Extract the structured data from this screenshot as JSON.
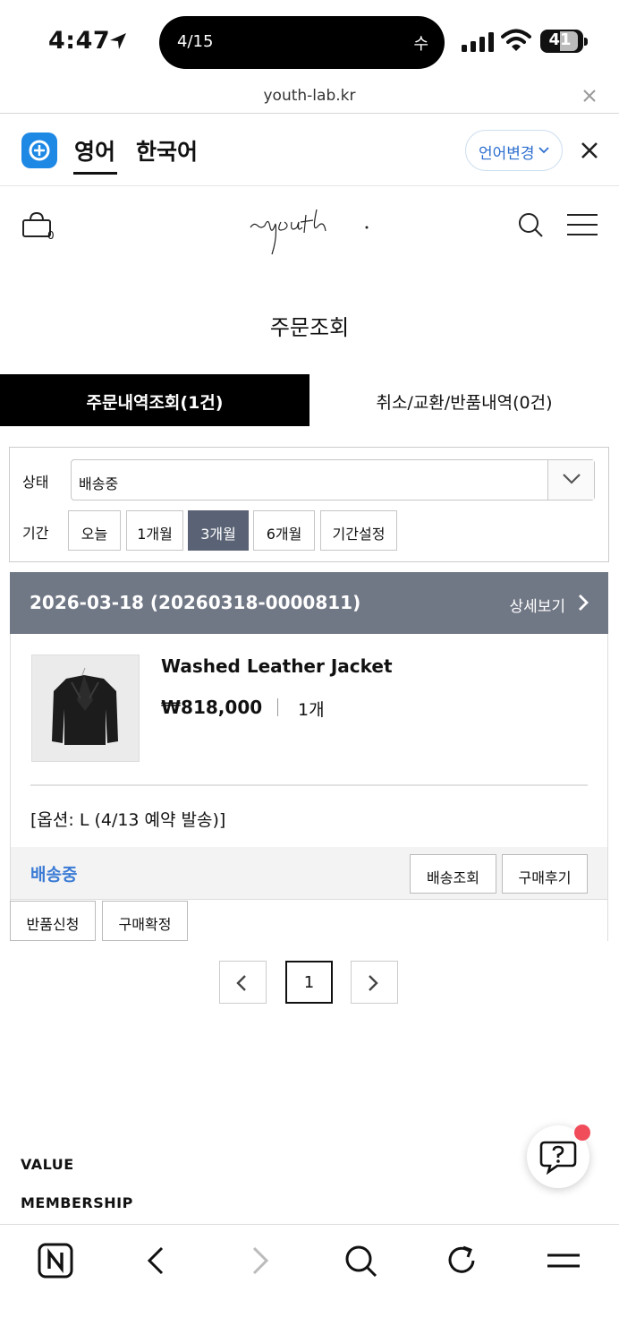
{
  "status": {
    "time": "4:47",
    "island_left": "4/15",
    "island_right": "수",
    "battery": "41"
  },
  "browser": {
    "url": "youth-lab.kr"
  },
  "translate": {
    "lang_active": "영어",
    "lang_other": "한국어",
    "change_label": "언어변경"
  },
  "header": {
    "cart_count": "0",
    "brand": "youth."
  },
  "page": {
    "title": "주문조회"
  },
  "tabs": [
    {
      "label": "주문내역조회(1건)",
      "active": true
    },
    {
      "label": "취소/교환/반품내역(0건)",
      "active": false
    }
  ],
  "filter": {
    "status_label": "상태",
    "status_value": "배송중",
    "period_label": "기간",
    "periods": [
      {
        "label": "오늘",
        "active": false
      },
      {
        "label": "1개월",
        "active": false
      },
      {
        "label": "3개월",
        "active": true
      },
      {
        "label": "6개월",
        "active": false
      },
      {
        "label": "기간설정",
        "active": false
      }
    ]
  },
  "order": {
    "date_id": "2026-03-18 (20260318-0000811)",
    "detail_label": "상세보기",
    "product_name": "Washed Leather Jacket",
    "price": "₩818,000",
    "qty": "1개",
    "option": "[옵션: L (4/13 예약 발송)]",
    "status": "배송중",
    "track_label": "배송조회",
    "review_label": "구매후기",
    "return_label": "반품신청",
    "confirm_label": "구매확정"
  },
  "pagination": {
    "current": "1"
  },
  "footer": {
    "link1": "VALUE",
    "link2": "MEMBERSHIP"
  },
  "colors": {
    "status_blue": "#3a7bd5",
    "header_gray": "#707785",
    "active_period": "#5a6375",
    "notify_red": "#f04c5a"
  }
}
